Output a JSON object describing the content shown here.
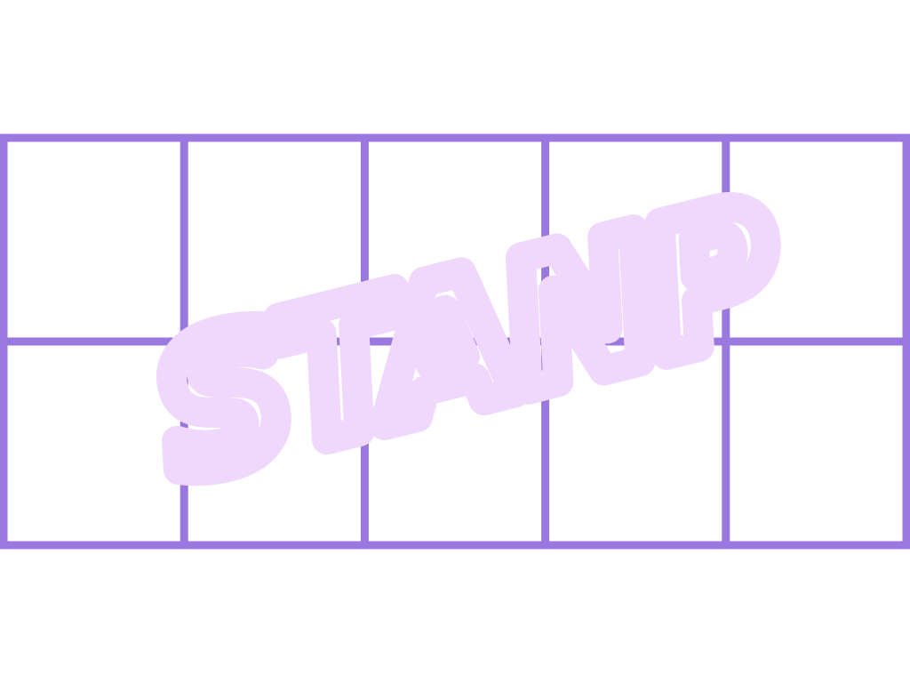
{
  "colors": {
    "background": "#ffffff",
    "grid_line": "#9b78e0",
    "stamp_fill": "#ffffff",
    "stamp_outline": "#f0d8fc"
  },
  "grid": {
    "rows": 2,
    "columns": 5,
    "cells": [
      {
        "row": 1,
        "col": 1
      },
      {
        "row": 1,
        "col": 2
      },
      {
        "row": 1,
        "col": 3
      },
      {
        "row": 1,
        "col": 4
      },
      {
        "row": 1,
        "col": 5
      },
      {
        "row": 2,
        "col": 1
      },
      {
        "row": 2,
        "col": 2
      },
      {
        "row": 2,
        "col": 3
      },
      {
        "row": 2,
        "col": 4
      },
      {
        "row": 2,
        "col": 5
      }
    ]
  },
  "watermark": {
    "text": "STANP",
    "icon": "stamp-watermark"
  }
}
